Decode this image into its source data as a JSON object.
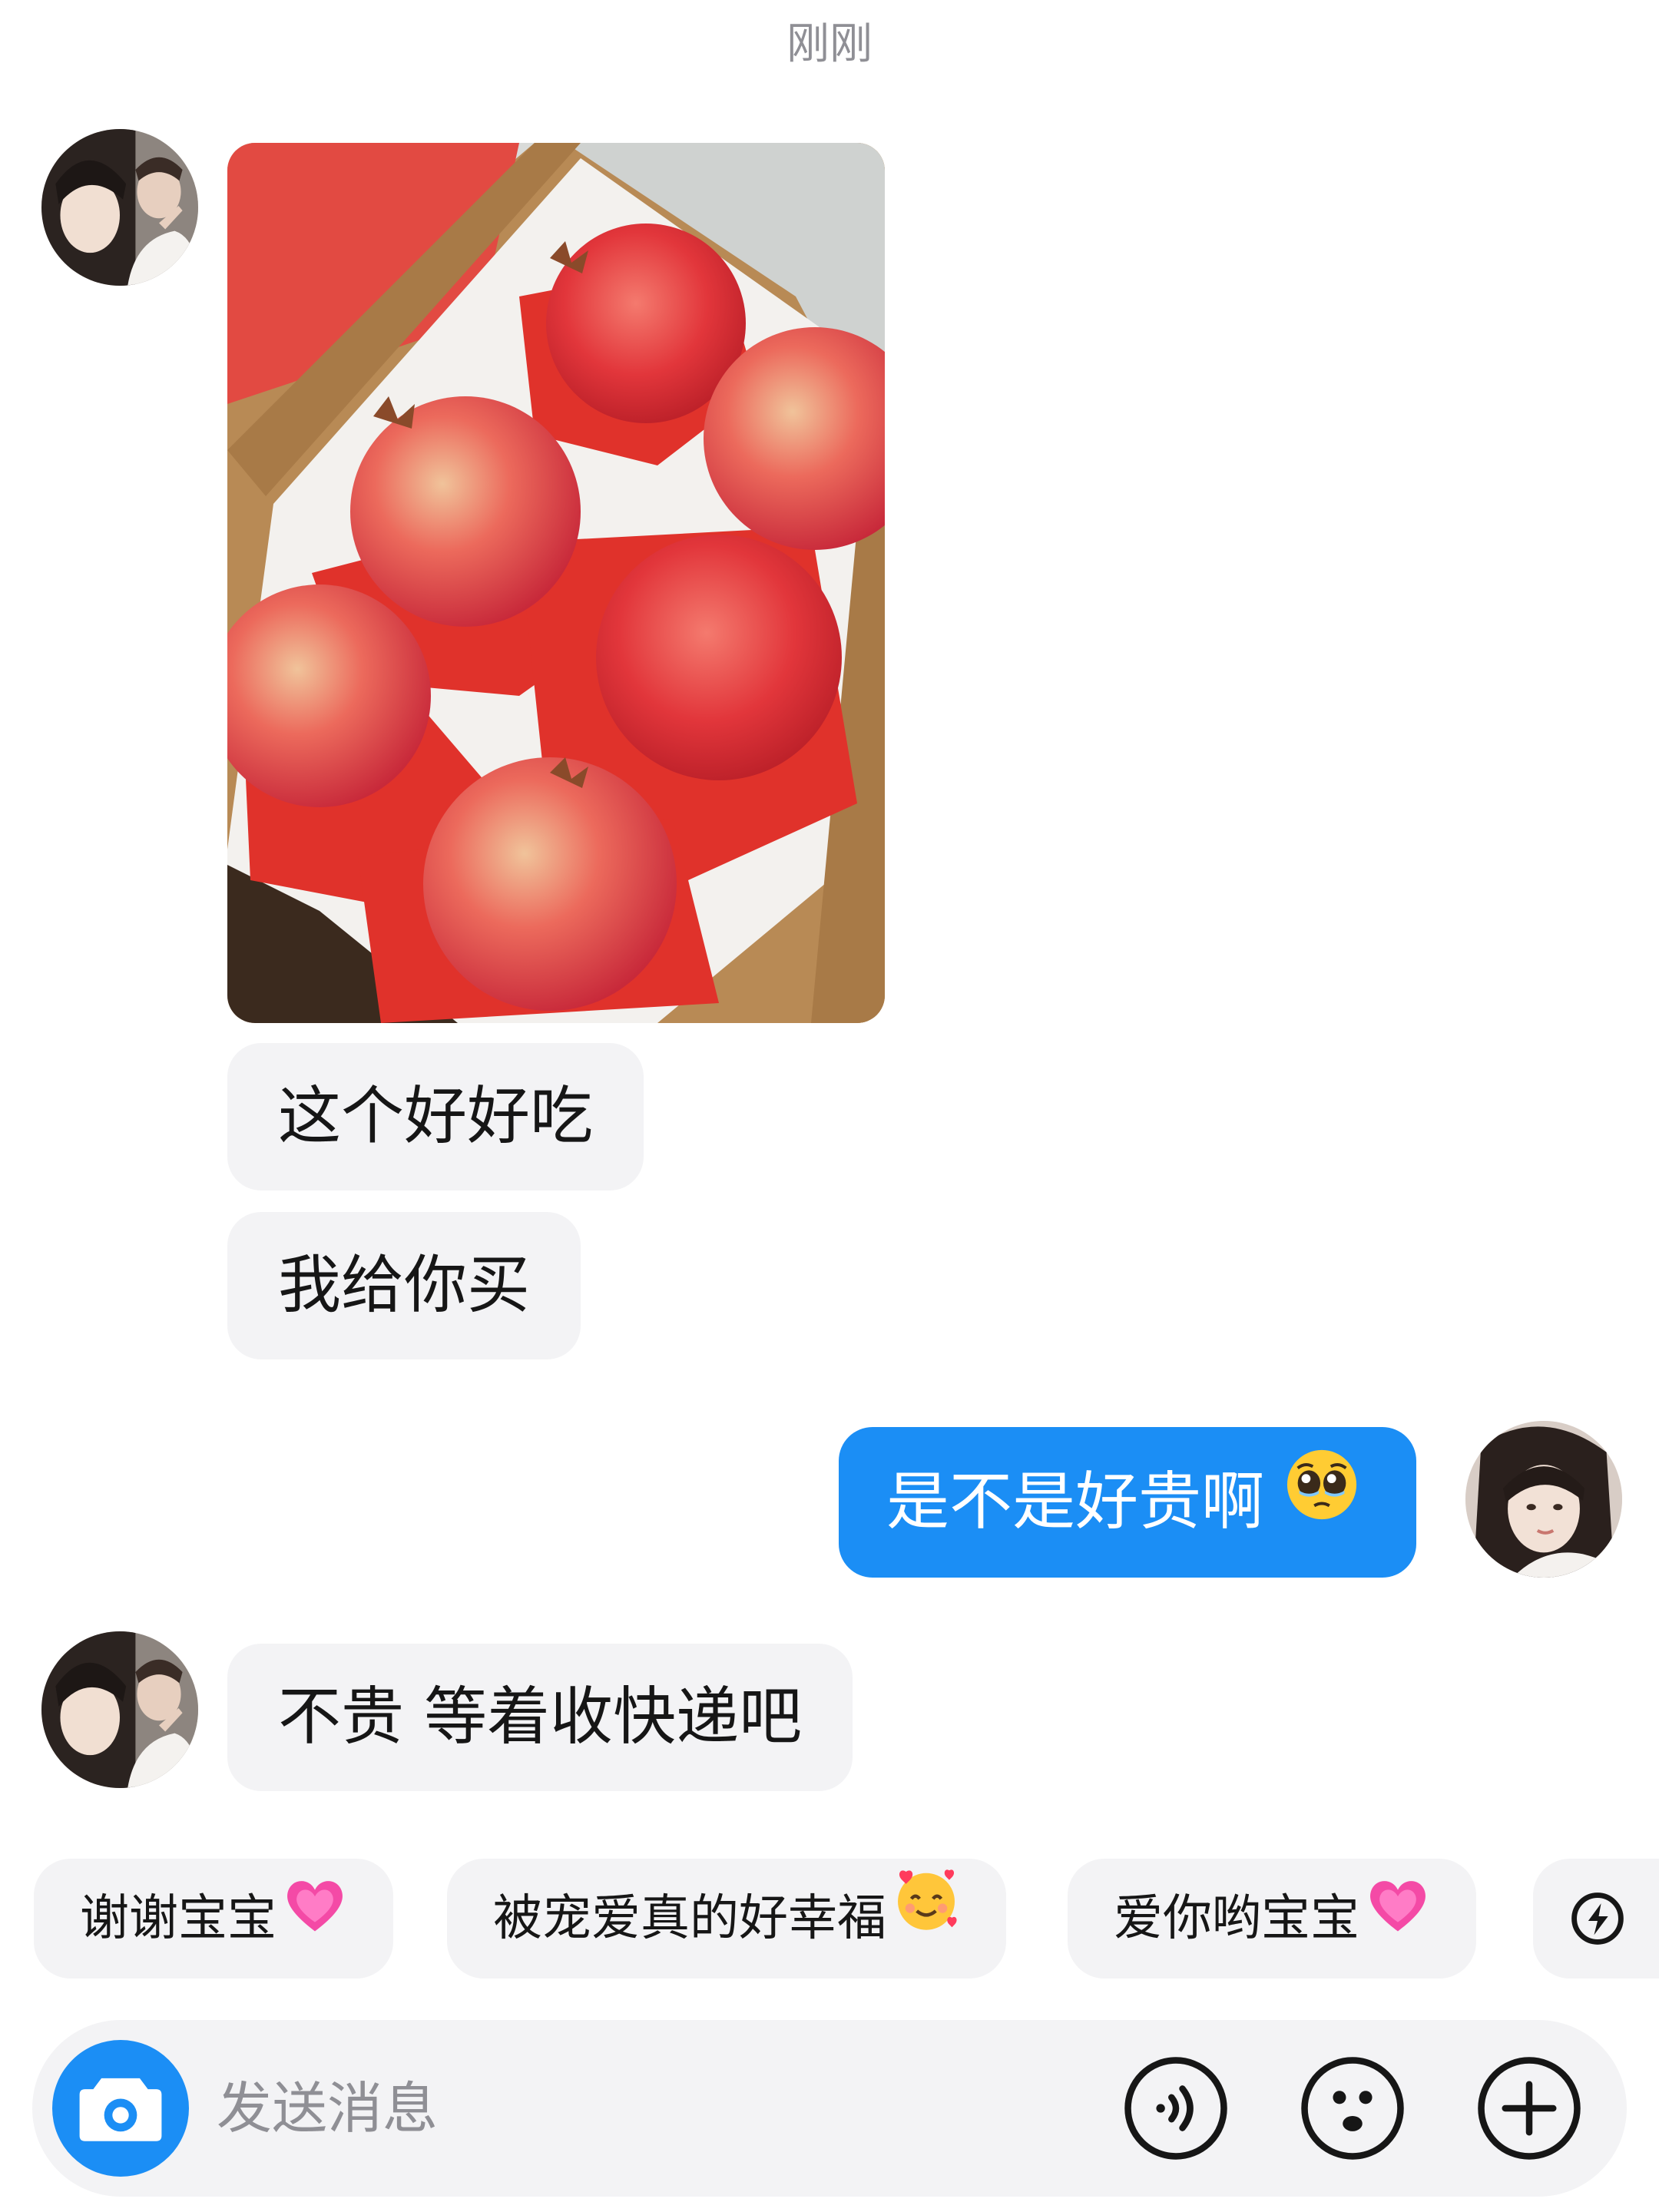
{
  "chat": {
    "timestamp": "刚刚",
    "messages": [
      {
        "sender": "them",
        "type": "image",
        "icon": "pomegranate-photo"
      },
      {
        "sender": "them",
        "type": "text",
        "text": "这个好好吃"
      },
      {
        "sender": "them",
        "type": "text",
        "text": "我给你买"
      },
      {
        "sender": "me",
        "type": "text",
        "text": "是不是好贵啊",
        "emoji": "pleading-face-icon"
      },
      {
        "sender": "them",
        "type": "text",
        "text": "不贵 等着收快递吧"
      }
    ]
  },
  "quick_replies": [
    {
      "text": "谢谢宝宝",
      "emoji": "heart-icon"
    },
    {
      "text": "被宠爱真的好幸福",
      "emoji": "smiling-face-with-hearts-icon"
    },
    {
      "text": "爱你哟宝宝",
      "emoji": "heart-icon"
    },
    {
      "icon": "lightning-icon"
    }
  ],
  "input_bar": {
    "placeholder": "发送消息",
    "camera_icon": "camera-icon",
    "voice_icon": "voice-icon",
    "emoji_icon": "emoji-icon",
    "more_icon": "plus-icon"
  },
  "colors": {
    "accent": "#1b8ef5",
    "bubble_incoming": "#f3f3f5",
    "background": "#ffffff",
    "secondary_text": "#8f8f95"
  }
}
